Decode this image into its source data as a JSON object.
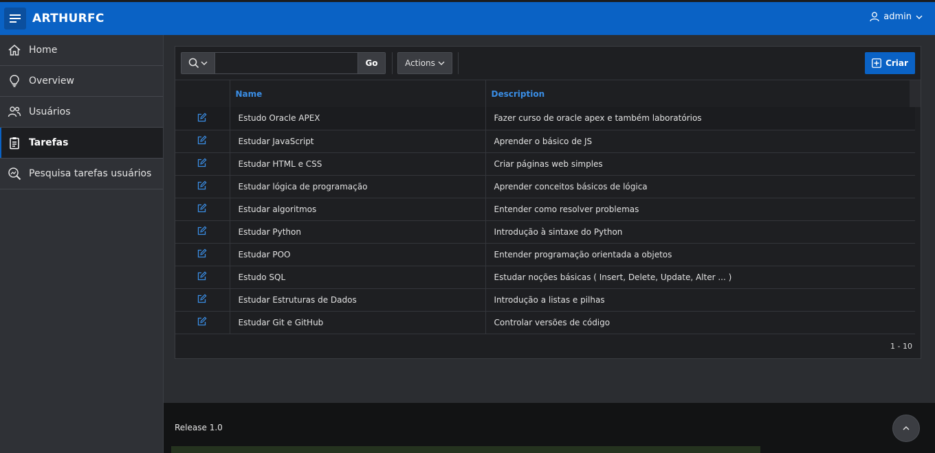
{
  "header": {
    "app_title": "ARTHURFC",
    "user_name": "admin"
  },
  "sidebar": {
    "items": [
      {
        "label": "Home",
        "icon": "home-icon",
        "active": false
      },
      {
        "label": "Overview",
        "icon": "lightbulb-icon",
        "active": false
      },
      {
        "label": "Usuários",
        "icon": "users-icon",
        "active": false
      },
      {
        "label": "Tarefas",
        "icon": "clipboard-icon",
        "active": true
      },
      {
        "label": "Pesquisa tarefas usuários",
        "icon": "search-chart-icon",
        "active": false
      }
    ]
  },
  "toolbar": {
    "search_value": "",
    "go_label": "Go",
    "actions_label": "Actions",
    "create_label": "Criar"
  },
  "report": {
    "columns": [
      "",
      "Name",
      "Description"
    ],
    "rows": [
      {
        "name": "Estudo Oracle APEX",
        "description": "Fazer curso de oracle apex e também laboratórios"
      },
      {
        "name": "Estudar JavaScript",
        "description": "Aprender o básico de JS"
      },
      {
        "name": "Estudar HTML e CSS",
        "description": "Criar páginas web simples"
      },
      {
        "name": "Estudar lógica de programação",
        "description": "Aprender conceitos básicos de lógica"
      },
      {
        "name": "Estudar algoritmos",
        "description": "Entender como resolver problemas"
      },
      {
        "name": "Estudar Python",
        "description": "Introdução à sintaxe do Python"
      },
      {
        "name": "Estudar POO",
        "description": "Entender programação orientada a objetos"
      },
      {
        "name": "Estudo SQL",
        "description": "Estudar noções básicas ( Insert, Delete, Update, Alter ... )"
      },
      {
        "name": "Estudar Estruturas de Dados",
        "description": "Introdução a listas e pilhas"
      },
      {
        "name": "Estudar Git e GitHub",
        "description": "Controlar versões de código"
      }
    ],
    "pagination": "1 - 10"
  },
  "footer": {
    "release": "Release 1.0"
  },
  "colors": {
    "accent": "#0a62c5",
    "link": "#3a8ee6"
  }
}
